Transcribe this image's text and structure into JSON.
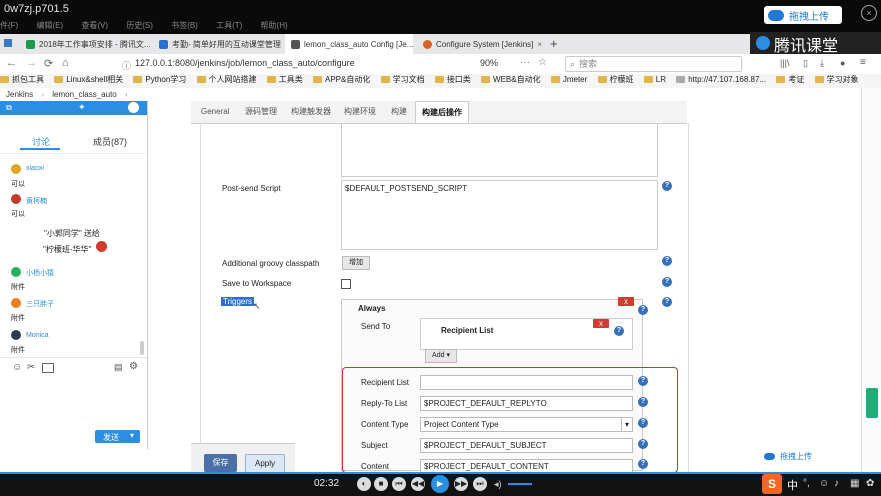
{
  "titlebar": {
    "title": "0w7zj.p701.5",
    "menu": [
      "件(F)",
      "编辑(E)",
      "查看(V)",
      "历史(S)",
      "书签(B)",
      "工具(T)",
      "帮助(H)"
    ],
    "upload_label": "拖拽上传"
  },
  "tabs": [
    {
      "label": "2018年工作事项安排 - 腾讯文...",
      "color": "#1a9a4b"
    },
    {
      "label": "考勤- 简单好用的互动课堂管理",
      "color": "#2a6fd6"
    },
    {
      "label": "lemon_class_auto Config [Je...",
      "color": "#555555",
      "active": true
    },
    {
      "label": "Configure System [Jenkins]",
      "color": "#d9622b"
    }
  ],
  "addressbar": {
    "url": "127.0.0.1:8080/jenkins/job/lemon_class_auto/configure",
    "zoom": "90%",
    "search_placeholder": "搜索",
    "brand": "腾讯课堂"
  },
  "bookmarks": [
    "抓包工具",
    "Linux&shell相关",
    "Python学习",
    "个人网站搭建",
    "工具类",
    "APP&自动化",
    "学习文档",
    "接口类",
    "WEB&自动化",
    "Jmeter",
    "柠檬班",
    "LR",
    "http://47.107.168.87...",
    "考证",
    "学习对象"
  ],
  "breadcrumb": [
    "Jenkins",
    "lemon_class_auto"
  ],
  "jenkins": {
    "tabs": [
      "General",
      "源码管理",
      "构建触发器",
      "构建环境",
      "构建",
      "构建后操作"
    ],
    "active_tab": "构建后操作",
    "post_send_label": "Post-send Script",
    "post_send_value": "$DEFAULT_POSTSEND_SCRIPT",
    "groovy_label": "Additional groovy classpath",
    "groovy_button": "增加",
    "save_ws_label": "Save to Workspace",
    "triggers_label": "Triggers",
    "always_label": "Always",
    "send_to_label": "Send To",
    "recipient_list_title": "Recipient List",
    "add_button": "Add",
    "fields": [
      {
        "label": "Recipient List",
        "value": ""
      },
      {
        "label": "Reply-To List",
        "value": "$PROJECT_DEFAULT_REPLYTO"
      },
      {
        "label": "Content Type",
        "value": "Project Content Type"
      },
      {
        "label": "Subject",
        "value": "$PROJECT_DEFAULT_SUBJECT"
      },
      {
        "label": "Content",
        "value": "$PROJECT_DEFAULT_CONTENT"
      }
    ],
    "save_button": "保存",
    "apply_button": "Apply",
    "red_x": "x",
    "help_glyph": "?"
  },
  "chat": {
    "tab_discuss": "讨论",
    "tab_members": "成员(87)",
    "messages": [
      {
        "name": "xiaoxi",
        "text": "可以",
        "color": "#e0a526"
      },
      {
        "name": "黄柯楠",
        "text": "可以",
        "color": "#c0392b"
      },
      {
        "name": "小杨小猿",
        "text": "附件",
        "color": "#27ae60"
      },
      {
        "name": "三只胖子",
        "text": "附件",
        "color": "#e67e22"
      },
      {
        "name": "Monica",
        "text": "附件",
        "color": "#2c3e50"
      }
    ],
    "gift_line1": "\"小郭同学\" 送给",
    "gift_line2": "\"柠檬班-华华\"",
    "send_button": "发送"
  },
  "player": {
    "time": "02:32"
  },
  "sogou": {
    "lang": "中"
  }
}
